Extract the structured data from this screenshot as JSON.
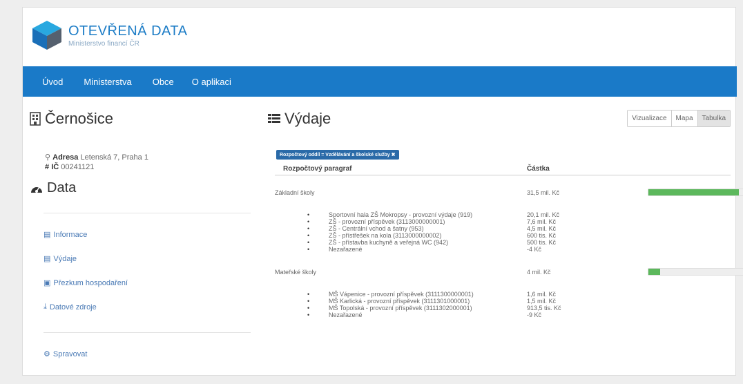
{
  "brand": {
    "title": "OTEVŘENÁ DATA",
    "subtitle": "Ministerstvo financí ČR"
  },
  "nav": {
    "items": [
      "Úvod",
      "Ministerstva",
      "Obce",
      "O aplikaci"
    ]
  },
  "left": {
    "title": "Černošice",
    "address_label": "Adresa",
    "address_value": "Letenská 7, Praha 1",
    "ic_label": "IČ",
    "ic_value": "00241121",
    "data_title": "Data",
    "menu": [
      "Informace",
      "Výdaje",
      "Přezkum hospodaření",
      "Datové zdroje"
    ],
    "manage": "Spravovat"
  },
  "right": {
    "title": "Výdaje",
    "view_buttons": [
      "Vizualizace",
      "Mapa",
      "Tabulka"
    ],
    "filter_badge": "Rozpočtový oddíl = Vzdělávání a školské služby ✖",
    "col_paragraph": "Rozpočtový paragraf",
    "col_amount": "Částka",
    "groups": [
      {
        "name": "Základní školy",
        "amount": "31,5 mil. Kč",
        "share": 0.92,
        "items": [
          {
            "name": "Sportovní hala ZŠ Mokropsy - provozní výdaje (919)",
            "amount": "20,1 mil. Kč"
          },
          {
            "name": "ZŠ - provozní příspěvek (3113000000001)",
            "amount": "7,6 mil. Kč"
          },
          {
            "name": "ZŠ - Centrální vchod a šatny (953)",
            "amount": "4,5 mil. Kč"
          },
          {
            "name": "ZŠ - přístřešek na kola (3113000000002)",
            "amount": "600 tis. Kč"
          },
          {
            "name": "ZŠ - přístavba kuchyně a veřejná WC (942)",
            "amount": "500 tis. Kč"
          },
          {
            "name": "Nezařazené",
            "amount": "-4 Kč"
          }
        ]
      },
      {
        "name": "Mateřské školy",
        "amount": "4 mil. Kč",
        "share": 0.12,
        "items": [
          {
            "name": "MŠ Vápenice - provozní příspěvek (3111300000001)",
            "amount": "1,6 mil. Kč"
          },
          {
            "name": "MŠ Karlická - provozní příspěvek (3111301000001)",
            "amount": "1,5 mil. Kč"
          },
          {
            "name": "MŠ Topolská - provozní příspěvek (3111302000001)",
            "amount": "913,5 tis. Kč"
          },
          {
            "name": "Nezařazené",
            "amount": "-9 Kč"
          }
        ]
      }
    ]
  },
  "colors": {
    "nav": "#1a7ac8",
    "bar_fill": "#5cb85c",
    "badge": "#2a6aa8"
  }
}
